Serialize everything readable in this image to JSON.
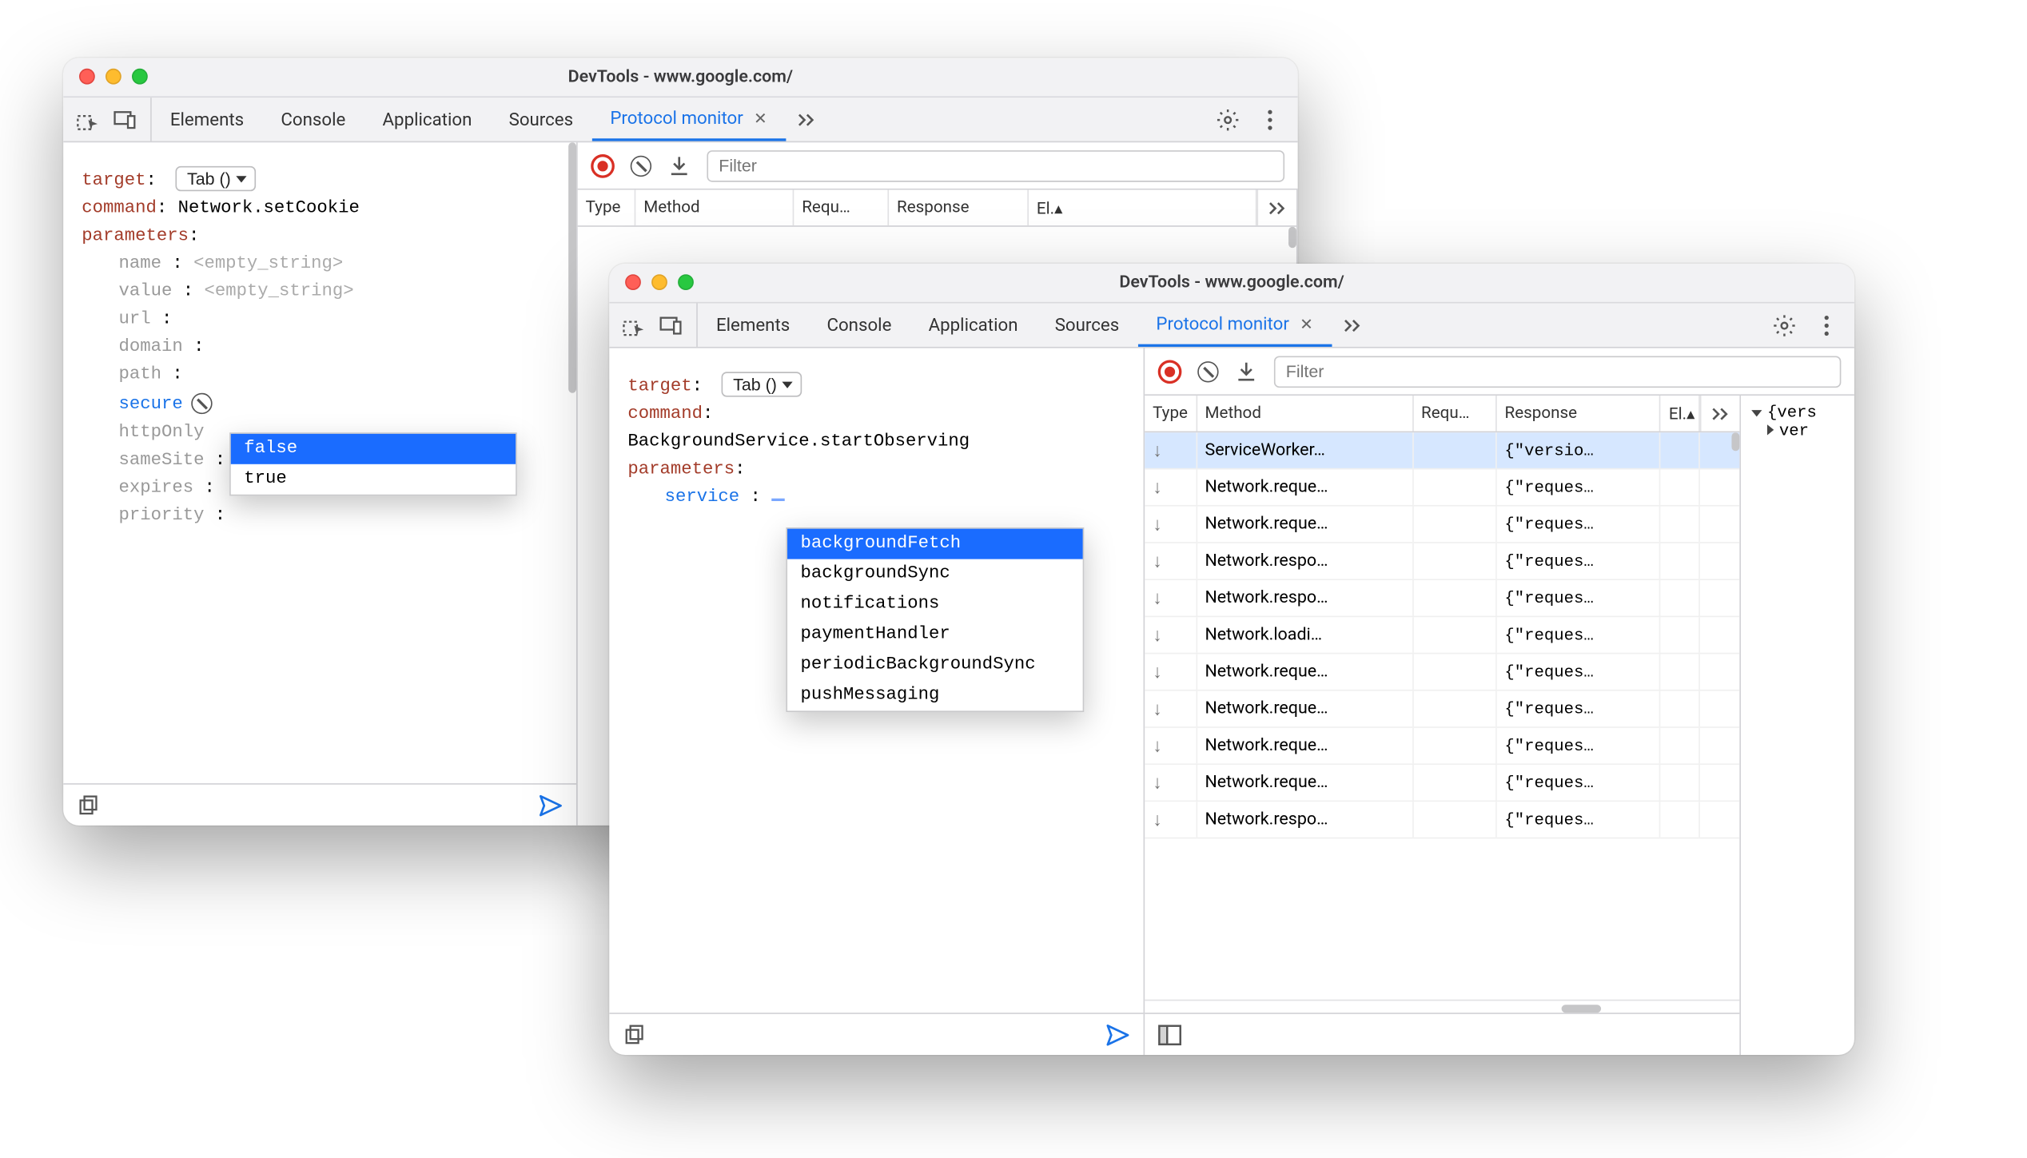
{
  "windowA": {
    "title": "DevTools - www.google.com/",
    "tabs": [
      "Elements",
      "Console",
      "Application",
      "Sources",
      "Protocol monitor"
    ],
    "activeTab": "Protocol monitor",
    "editor": {
      "targetLabel": "target",
      "targetValue": "Tab ()",
      "commandLabel": "command",
      "commandValue": "Network.setCookie",
      "parametersLabel": "parameters",
      "params": {
        "name": {
          "label": "name",
          "value": "<empty_string>"
        },
        "value": {
          "label": "value",
          "value": "<empty_string>"
        },
        "url": {
          "label": "url"
        },
        "domain": {
          "label": "domain"
        },
        "path": {
          "label": "path"
        },
        "secure": {
          "label": "secure",
          "value": "false"
        },
        "httpOnly": {
          "label": "httpOnly"
        },
        "sameSite": {
          "label": "sameSite"
        },
        "expires": {
          "label": "expires"
        },
        "priority": {
          "label": "priority"
        }
      },
      "autocomplete": [
        "false",
        "true"
      ]
    },
    "table": {
      "filterPlaceholder": "Filter",
      "headers": {
        "type": "Type",
        "method": "Method",
        "request": "Requ…",
        "response": "Response",
        "elapsed": "El.▴"
      }
    }
  },
  "windowB": {
    "title": "DevTools - www.google.com/",
    "tabs": [
      "Elements",
      "Console",
      "Application",
      "Sources",
      "Protocol monitor"
    ],
    "activeTab": "Protocol monitor",
    "editor": {
      "targetLabel": "target",
      "targetValue": "Tab ()",
      "commandLabel": "command",
      "commandValue": "BackgroundService.startObserving",
      "parametersLabel": "parameters",
      "params": {
        "service": {
          "label": "service"
        }
      },
      "autocomplete": [
        "backgroundFetch",
        "backgroundSync",
        "notifications",
        "paymentHandler",
        "periodicBackgroundSync",
        "pushMessaging"
      ]
    },
    "table": {
      "filterPlaceholder": "Filter",
      "headers": {
        "type": "Type",
        "method": "Method",
        "request": "Requ…",
        "response": "Response",
        "elapsed": "El.▴"
      },
      "rows": [
        {
          "method": "ServiceWorker…",
          "response": "{\"versio…",
          "sel": true
        },
        {
          "method": "Network.reque…",
          "response": "{\"reques…"
        },
        {
          "method": "Network.reque…",
          "response": "{\"reques…"
        },
        {
          "method": "Network.respo…",
          "response": "{\"reques…"
        },
        {
          "method": "Network.respo…",
          "response": "{\"reques…"
        },
        {
          "method": "Network.loadi…",
          "response": "{\"reques…"
        },
        {
          "method": "Network.reque…",
          "response": "{\"reques…"
        },
        {
          "method": "Network.reque…",
          "response": "{\"reques…"
        },
        {
          "method": "Network.reque…",
          "response": "{\"reques…"
        },
        {
          "method": "Network.reque…",
          "response": "{\"reques…"
        },
        {
          "method": "Network.respo…",
          "response": "{\"reques…"
        }
      ],
      "detail": {
        "root": "{vers",
        "child": "ver"
      }
    }
  }
}
